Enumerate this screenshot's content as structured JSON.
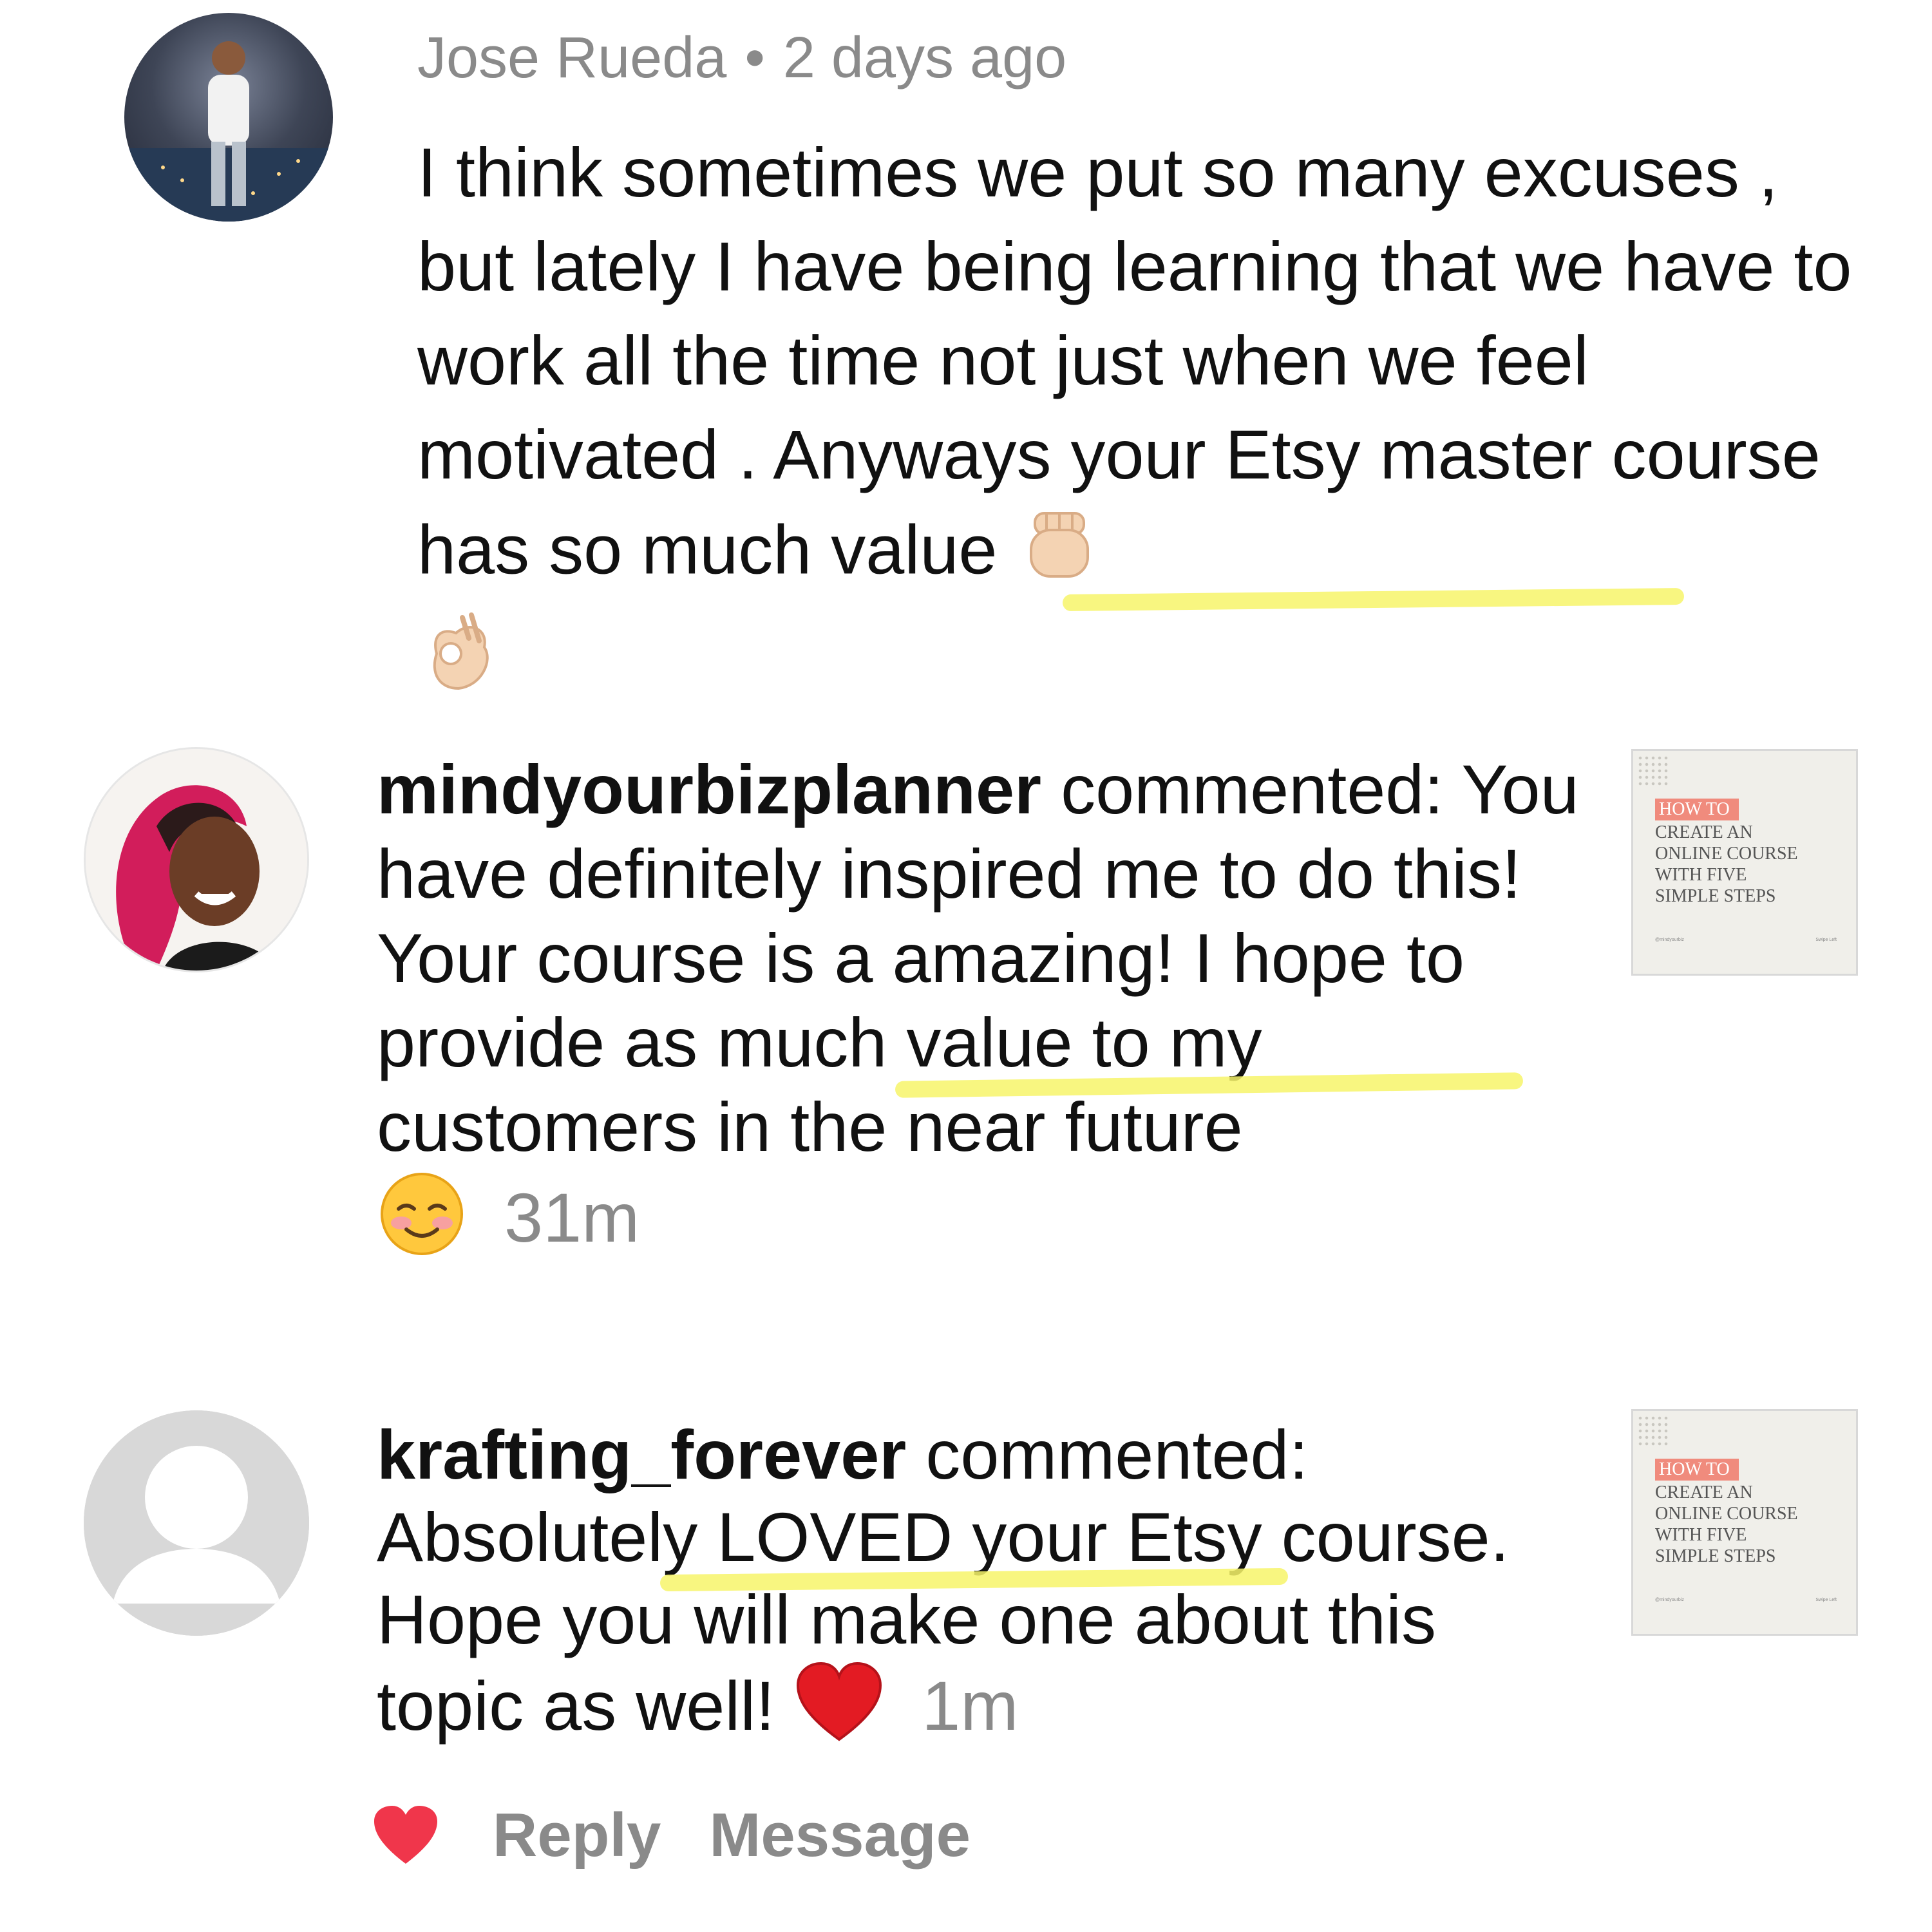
{
  "comments": [
    {
      "author": "Jose Rueda",
      "separator": "•",
      "time": "2 days ago",
      "text_before": "I think sometimes we put so many excuses , but lately I have being learning that we have to work all the time not just when we feel motivated . Anyways your Etsy master course has so much value",
      "emojis": [
        "raised-fist-emoji",
        "ok-hand-emoji"
      ]
    },
    {
      "username": "mindyourbizplanner",
      "action": "commented:",
      "text": "You have definitely inspired me to do this! Your course is a amazing! I hope to provide as much value to my customers in the near future",
      "emoji": "smiling-blush-emoji",
      "time": "31m",
      "thumbnail": {
        "tag": "HOW TO",
        "title_lines": [
          "CREATE AN",
          "ONLINE COURSE",
          "WITH FIVE",
          "SIMPLE STEPS"
        ],
        "footer_left": "@mindyourbiz",
        "footer_right": "Swipe Left"
      }
    },
    {
      "username": "krafting_forever",
      "action": "commented:",
      "text": "Absolutely LOVED your Etsy course. Hope you will make one about this topic as well!",
      "emoji": "red-heart-emoji",
      "time": "1m",
      "thumbnail": {
        "tag": "HOW TO",
        "title_lines": [
          "CREATE AN",
          "ONLINE COURSE",
          "WITH FIVE",
          "SIMPLE STEPS"
        ],
        "footer_left": "@mindyourbiz",
        "footer_right": "Swipe Left"
      }
    }
  ],
  "actions": {
    "like_icon": "heart-icon",
    "reply_label": "Reply",
    "message_label": "Message",
    "like_color": "#f0364b"
  },
  "colors": {
    "highlight": "#f7f56a",
    "meta_text": "#8a8a8a",
    "thumbnail_tag": "#f08b7d"
  }
}
